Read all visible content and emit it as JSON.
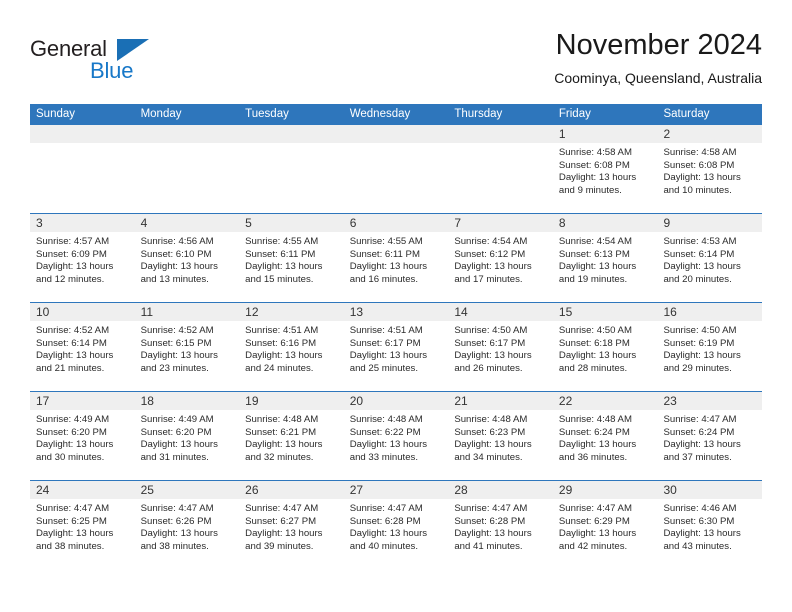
{
  "brand": {
    "name_part1": "General",
    "name_part2": "Blue",
    "triangle_color": "#1a6fb5"
  },
  "header": {
    "title": "November 2024",
    "subtitle": "Coominya, Queensland, Australia"
  },
  "theme": {
    "header_blue": "#2e76bc",
    "daynum_band": "#efefef",
    "text": "#2b2b2b"
  },
  "weekdays": [
    "Sunday",
    "Monday",
    "Tuesday",
    "Wednesday",
    "Thursday",
    "Friday",
    "Saturday"
  ],
  "weeks": [
    [
      {
        "day": "",
        "sunrise": "",
        "sunset": "",
        "daylight": "",
        "empty": true
      },
      {
        "day": "",
        "sunrise": "",
        "sunset": "",
        "daylight": "",
        "empty": true
      },
      {
        "day": "",
        "sunrise": "",
        "sunset": "",
        "daylight": "",
        "empty": true
      },
      {
        "day": "",
        "sunrise": "",
        "sunset": "",
        "daylight": "",
        "empty": true
      },
      {
        "day": "",
        "sunrise": "",
        "sunset": "",
        "daylight": "",
        "empty": true
      },
      {
        "day": "1",
        "sunrise": "Sunrise: 4:58 AM",
        "sunset": "Sunset: 6:08 PM",
        "daylight": "Daylight: 13 hours and 9 minutes.",
        "empty": false
      },
      {
        "day": "2",
        "sunrise": "Sunrise: 4:58 AM",
        "sunset": "Sunset: 6:08 PM",
        "daylight": "Daylight: 13 hours and 10 minutes.",
        "empty": false
      }
    ],
    [
      {
        "day": "3",
        "sunrise": "Sunrise: 4:57 AM",
        "sunset": "Sunset: 6:09 PM",
        "daylight": "Daylight: 13 hours and 12 minutes.",
        "empty": false
      },
      {
        "day": "4",
        "sunrise": "Sunrise: 4:56 AM",
        "sunset": "Sunset: 6:10 PM",
        "daylight": "Daylight: 13 hours and 13 minutes.",
        "empty": false
      },
      {
        "day": "5",
        "sunrise": "Sunrise: 4:55 AM",
        "sunset": "Sunset: 6:11 PM",
        "daylight": "Daylight: 13 hours and 15 minutes.",
        "empty": false
      },
      {
        "day": "6",
        "sunrise": "Sunrise: 4:55 AM",
        "sunset": "Sunset: 6:11 PM",
        "daylight": "Daylight: 13 hours and 16 minutes.",
        "empty": false
      },
      {
        "day": "7",
        "sunrise": "Sunrise: 4:54 AM",
        "sunset": "Sunset: 6:12 PM",
        "daylight": "Daylight: 13 hours and 17 minutes.",
        "empty": false
      },
      {
        "day": "8",
        "sunrise": "Sunrise: 4:54 AM",
        "sunset": "Sunset: 6:13 PM",
        "daylight": "Daylight: 13 hours and 19 minutes.",
        "empty": false
      },
      {
        "day": "9",
        "sunrise": "Sunrise: 4:53 AM",
        "sunset": "Sunset: 6:14 PM",
        "daylight": "Daylight: 13 hours and 20 minutes.",
        "empty": false
      }
    ],
    [
      {
        "day": "10",
        "sunrise": "Sunrise: 4:52 AM",
        "sunset": "Sunset: 6:14 PM",
        "daylight": "Daylight: 13 hours and 21 minutes.",
        "empty": false
      },
      {
        "day": "11",
        "sunrise": "Sunrise: 4:52 AM",
        "sunset": "Sunset: 6:15 PM",
        "daylight": "Daylight: 13 hours and 23 minutes.",
        "empty": false
      },
      {
        "day": "12",
        "sunrise": "Sunrise: 4:51 AM",
        "sunset": "Sunset: 6:16 PM",
        "daylight": "Daylight: 13 hours and 24 minutes.",
        "empty": false
      },
      {
        "day": "13",
        "sunrise": "Sunrise: 4:51 AM",
        "sunset": "Sunset: 6:17 PM",
        "daylight": "Daylight: 13 hours and 25 minutes.",
        "empty": false
      },
      {
        "day": "14",
        "sunrise": "Sunrise: 4:50 AM",
        "sunset": "Sunset: 6:17 PM",
        "daylight": "Daylight: 13 hours and 26 minutes.",
        "empty": false
      },
      {
        "day": "15",
        "sunrise": "Sunrise: 4:50 AM",
        "sunset": "Sunset: 6:18 PM",
        "daylight": "Daylight: 13 hours and 28 minutes.",
        "empty": false
      },
      {
        "day": "16",
        "sunrise": "Sunrise: 4:50 AM",
        "sunset": "Sunset: 6:19 PM",
        "daylight": "Daylight: 13 hours and 29 minutes.",
        "empty": false
      }
    ],
    [
      {
        "day": "17",
        "sunrise": "Sunrise: 4:49 AM",
        "sunset": "Sunset: 6:20 PM",
        "daylight": "Daylight: 13 hours and 30 minutes.",
        "empty": false
      },
      {
        "day": "18",
        "sunrise": "Sunrise: 4:49 AM",
        "sunset": "Sunset: 6:20 PM",
        "daylight": "Daylight: 13 hours and 31 minutes.",
        "empty": false
      },
      {
        "day": "19",
        "sunrise": "Sunrise: 4:48 AM",
        "sunset": "Sunset: 6:21 PM",
        "daylight": "Daylight: 13 hours and 32 minutes.",
        "empty": false
      },
      {
        "day": "20",
        "sunrise": "Sunrise: 4:48 AM",
        "sunset": "Sunset: 6:22 PM",
        "daylight": "Daylight: 13 hours and 33 minutes.",
        "empty": false
      },
      {
        "day": "21",
        "sunrise": "Sunrise: 4:48 AM",
        "sunset": "Sunset: 6:23 PM",
        "daylight": "Daylight: 13 hours and 34 minutes.",
        "empty": false
      },
      {
        "day": "22",
        "sunrise": "Sunrise: 4:48 AM",
        "sunset": "Sunset: 6:24 PM",
        "daylight": "Daylight: 13 hours and 36 minutes.",
        "empty": false
      },
      {
        "day": "23",
        "sunrise": "Sunrise: 4:47 AM",
        "sunset": "Sunset: 6:24 PM",
        "daylight": "Daylight: 13 hours and 37 minutes.",
        "empty": false
      }
    ],
    [
      {
        "day": "24",
        "sunrise": "Sunrise: 4:47 AM",
        "sunset": "Sunset: 6:25 PM",
        "daylight": "Daylight: 13 hours and 38 minutes.",
        "empty": false
      },
      {
        "day": "25",
        "sunrise": "Sunrise: 4:47 AM",
        "sunset": "Sunset: 6:26 PM",
        "daylight": "Daylight: 13 hours and 38 minutes.",
        "empty": false
      },
      {
        "day": "26",
        "sunrise": "Sunrise: 4:47 AM",
        "sunset": "Sunset: 6:27 PM",
        "daylight": "Daylight: 13 hours and 39 minutes.",
        "empty": false
      },
      {
        "day": "27",
        "sunrise": "Sunrise: 4:47 AM",
        "sunset": "Sunset: 6:28 PM",
        "daylight": "Daylight: 13 hours and 40 minutes.",
        "empty": false
      },
      {
        "day": "28",
        "sunrise": "Sunrise: 4:47 AM",
        "sunset": "Sunset: 6:28 PM",
        "daylight": "Daylight: 13 hours and 41 minutes.",
        "empty": false
      },
      {
        "day": "29",
        "sunrise": "Sunrise: 4:47 AM",
        "sunset": "Sunset: 6:29 PM",
        "daylight": "Daylight: 13 hours and 42 minutes.",
        "empty": false
      },
      {
        "day": "30",
        "sunrise": "Sunrise: 4:46 AM",
        "sunset": "Sunset: 6:30 PM",
        "daylight": "Daylight: 13 hours and 43 minutes.",
        "empty": false
      }
    ]
  ]
}
